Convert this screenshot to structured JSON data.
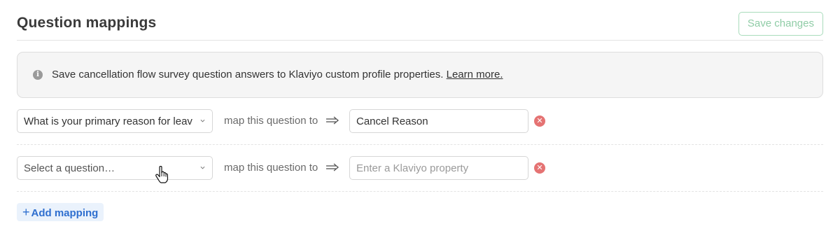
{
  "header": {
    "title": "Question mappings",
    "save_label": "Save changes"
  },
  "banner": {
    "icon": "info-icon",
    "text": "Save cancellation flow survey question answers to Klaviyo custom profile properties. ",
    "link": "Learn more."
  },
  "mappings": [
    {
      "question": "What is your primary reason for leav",
      "map_label": "map this question to",
      "property_value": "Cancel Reason",
      "property_placeholder": ""
    },
    {
      "question": "Select a question…",
      "map_label": "map this question to",
      "property_value": "",
      "property_placeholder": "Enter a Klaviyo property"
    }
  ],
  "add_mapping": {
    "icon": "plus-icon",
    "label": "Add mapping"
  },
  "colors": {
    "save_border": "#a9dcbb",
    "remove": "#e57373",
    "link_blue": "#2f6fcf"
  }
}
